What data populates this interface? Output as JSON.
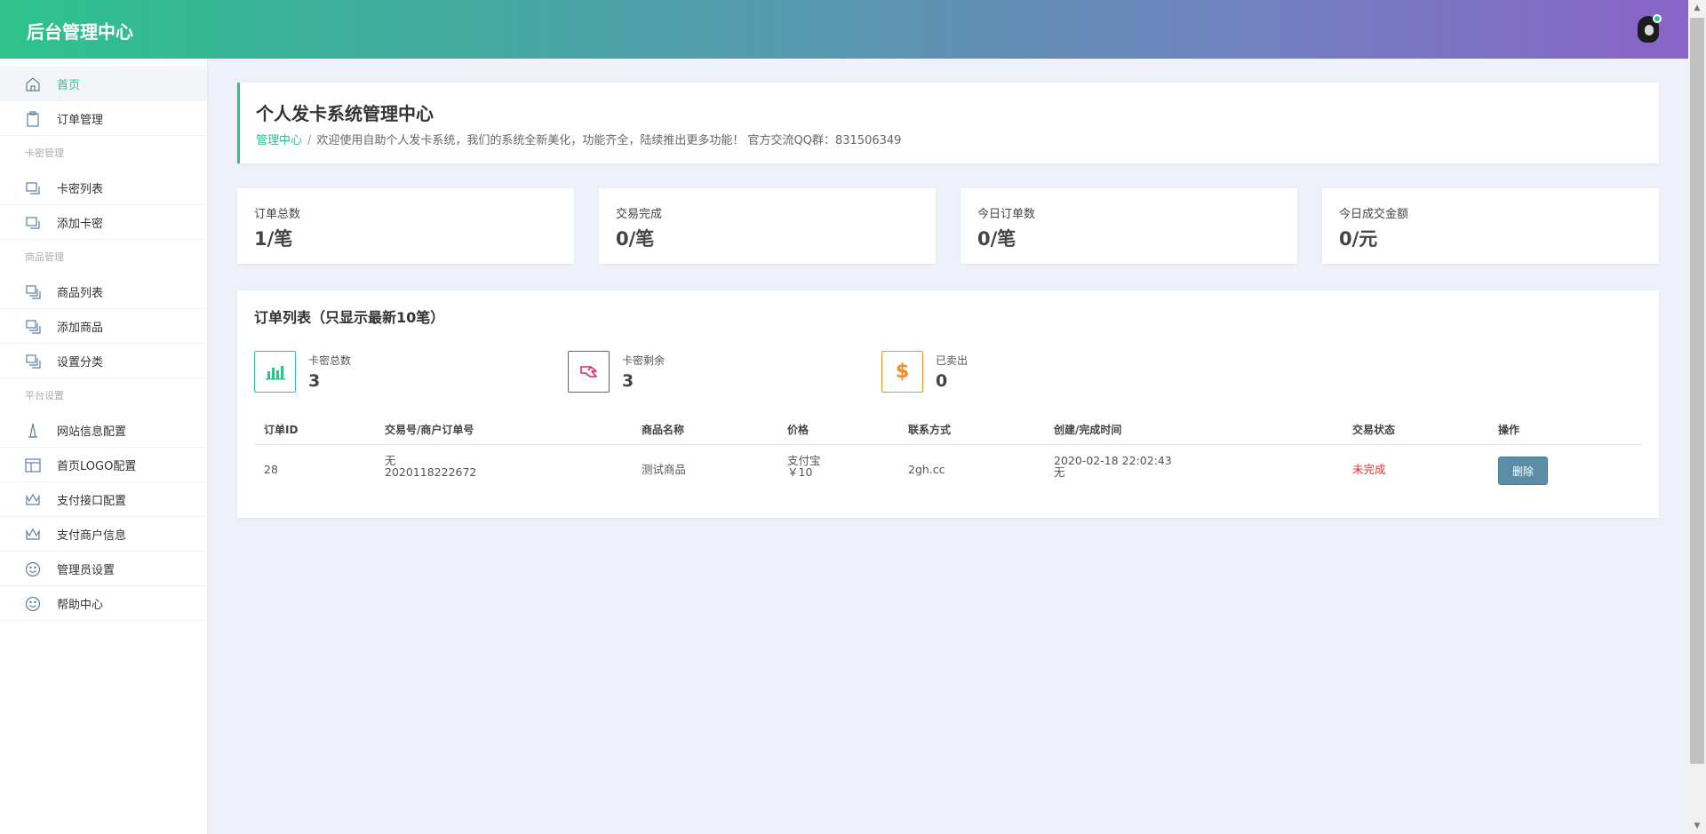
{
  "header": {
    "brand": "后台管理中心"
  },
  "sidebar": {
    "items": [
      {
        "label": "首页",
        "icon": "home-icon",
        "active": true
      },
      {
        "label": "订单管理",
        "icon": "clipboard-icon"
      },
      {
        "group": "卡密管理"
      },
      {
        "label": "卡密列表",
        "icon": "copy-icon"
      },
      {
        "label": "添加卡密",
        "icon": "copy-icon"
      },
      {
        "group": "商品管理"
      },
      {
        "label": "商品列表",
        "icon": "layers-icon"
      },
      {
        "label": "添加商品",
        "icon": "layers-icon"
      },
      {
        "label": "设置分类",
        "icon": "layers-icon"
      },
      {
        "group": "平台设置"
      },
      {
        "label": "网站信息配置",
        "icon": "tower-icon"
      },
      {
        "label": "首页LOGO配置",
        "icon": "layout-icon"
      },
      {
        "label": "支付接口配置",
        "icon": "crown-icon"
      },
      {
        "label": "支付商户信息",
        "icon": "crown-icon"
      },
      {
        "label": "管理员设置",
        "icon": "smile-icon"
      },
      {
        "label": "帮助中心",
        "icon": "smile-icon"
      }
    ]
  },
  "page": {
    "title": "个人发卡系统管理中心",
    "breadcrumb_home": "管理中心",
    "breadcrumb_sep": "/",
    "welcome": "欢迎使用自助个人发卡系统，我们的系统全新美化，功能齐全，陆续推出更多功能！ 官方交流QQ群：831506349"
  },
  "stats": [
    {
      "label": "订单总数",
      "value": "1/笔"
    },
    {
      "label": "交易完成",
      "value": "0/笔"
    },
    {
      "label": "今日订单数",
      "value": "0/笔"
    },
    {
      "label": "今日成交金额",
      "value": "0/元"
    }
  ],
  "orders": {
    "title": "订单列表（只显示最新10笔）",
    "mini_stats": [
      {
        "label": "卡密总数",
        "value": "3",
        "icon": "bar-chart-icon",
        "color": "#2dc28c"
      },
      {
        "label": "卡密剩余",
        "value": "3",
        "icon": "hand-icon",
        "color": "#e0245e"
      },
      {
        "label": "已卖出",
        "value": "0",
        "icon": "dollar-icon",
        "color": "#f28c28"
      }
    ],
    "columns": [
      "订单ID",
      "交易号/商户订单号",
      "商品名称",
      "价格",
      "联系方式",
      "创建/完成时间",
      "交易状态",
      "操作"
    ],
    "rows": [
      {
        "id": "28",
        "trade_no": "无",
        "merchant_no": "2020118222672",
        "product": "测试商品",
        "pay_method": "支付宝",
        "price": "￥10",
        "contact": "2gh.cc",
        "created": "2020-02-18 22:02:43",
        "finished": "无",
        "status": "未完成",
        "action": "删除"
      }
    ]
  },
  "colors": {
    "accent": "#2dc28c",
    "danger": "#e03131",
    "button": "#5b8ea6"
  }
}
